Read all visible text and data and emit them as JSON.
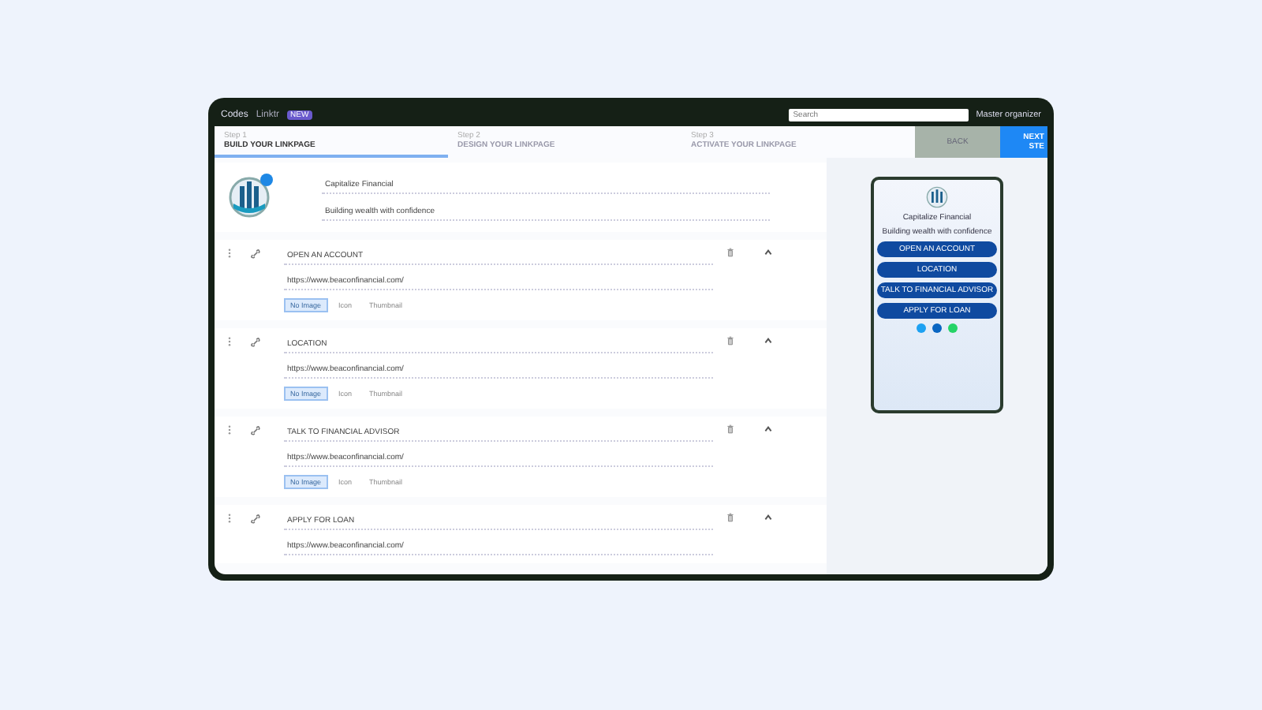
{
  "topbar": {
    "brand": "Codes",
    "product": "Linktr",
    "badge": "NEW",
    "search": {
      "placeholder": "Search"
    },
    "account": "Master organizer"
  },
  "steps": [
    {
      "step": "Step 1",
      "label": "BUILD YOUR LINKPAGE",
      "selected": true
    },
    {
      "step": "Step 2",
      "label": "DESIGN YOUR LINKPAGE",
      "selected": false
    },
    {
      "step": "Step 3",
      "label": "ACTIVATE YOUR LINKPAGE",
      "selected": false
    }
  ],
  "actions": {
    "back": "BACK",
    "next": "NEXT STE"
  },
  "profile": {
    "name": "Capitalize Financial",
    "tagline": "Building wealth with confidence"
  },
  "links": [
    {
      "title": "OPEN AN ACCOUNT",
      "url": "https://www.beaconfinancial.com/",
      "expanded": true,
      "options": [
        {
          "label": "No Image",
          "selected": true
        },
        {
          "label": "Icon",
          "selected": false
        },
        {
          "label": "Thumbnail",
          "selected": false
        }
      ]
    },
    {
      "title": "LOCATION",
      "url": "https://www.beaconfinancial.com/",
      "expanded": true,
      "options": [
        {
          "label": "No Image",
          "selected": true
        },
        {
          "label": "Icon",
          "selected": false
        },
        {
          "label": "Thumbnail",
          "selected": false
        }
      ]
    },
    {
      "title": "TALK TO FINANCIAL ADVISOR",
      "url": "https://www.beaconfinancial.com/",
      "expanded": true,
      "options": [
        {
          "label": "No Image",
          "selected": true
        },
        {
          "label": "Icon",
          "selected": false
        },
        {
          "label": "Thumbnail",
          "selected": false
        }
      ]
    },
    {
      "title": "APPLY FOR LOAN",
      "url": "https://www.beaconfinancial.com/",
      "expanded": true
    }
  ],
  "preview": {
    "name": "Capitalize Financial",
    "tagline": "Building wealth with confidence",
    "buttons": [
      "OPEN AN ACCOUNT",
      "LOCATION",
      "TALK TO FINANCIAL ADVISOR",
      "APPLY FOR LOAN"
    ]
  }
}
